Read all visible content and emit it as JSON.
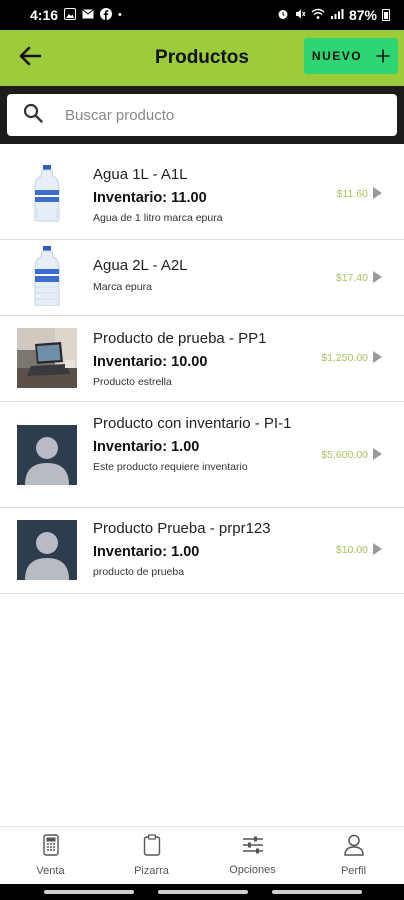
{
  "status_bar": {
    "time": "4:16",
    "battery": "87%"
  },
  "header": {
    "title": "Productos",
    "new_label": "NUEVO"
  },
  "search": {
    "placeholder": "Buscar producto",
    "value": ""
  },
  "products": [
    {
      "name": "Agua 1L - A1L",
      "inventory": "Inventario: 11.00",
      "description": "Agua de 1 litro marca epura",
      "price": "$11.60",
      "thumb": "water-bottle"
    },
    {
      "name": "Agua 2L - A2L",
      "inventory": "",
      "description": "Marca epura",
      "price": "$17.40",
      "thumb": "water-bottle"
    },
    {
      "name": "Producto de prueba - PP1",
      "inventory": "Inventario: 10.00",
      "description": "Producto estrella",
      "price": "$1,250.00",
      "thumb": "laptop-photo"
    },
    {
      "name": "Producto con inventario - PI-1",
      "inventory": "Inventario: 1.00",
      "description": "Este producto requiere inventario",
      "price": "$5,600.00",
      "thumb": "placeholder-avatar"
    },
    {
      "name": "Producto Prueba - prpr123",
      "inventory": "Inventario: 1.00",
      "description": "producto de prueba",
      "price": "$10.00",
      "thumb": "placeholder-avatar"
    }
  ],
  "bottom_nav": [
    {
      "label": "Venta",
      "icon": "register-icon"
    },
    {
      "label": "Pizarra",
      "icon": "clipboard-icon"
    },
    {
      "label": "Opciones",
      "icon": "sliders-icon"
    },
    {
      "label": "Perfil",
      "icon": "person-icon"
    }
  ],
  "colors": {
    "header": "#9ccc3b",
    "new_button": "#2ed573",
    "price": "#a5c35a",
    "placeholder_avatar_bg": "#2e3d4d"
  }
}
